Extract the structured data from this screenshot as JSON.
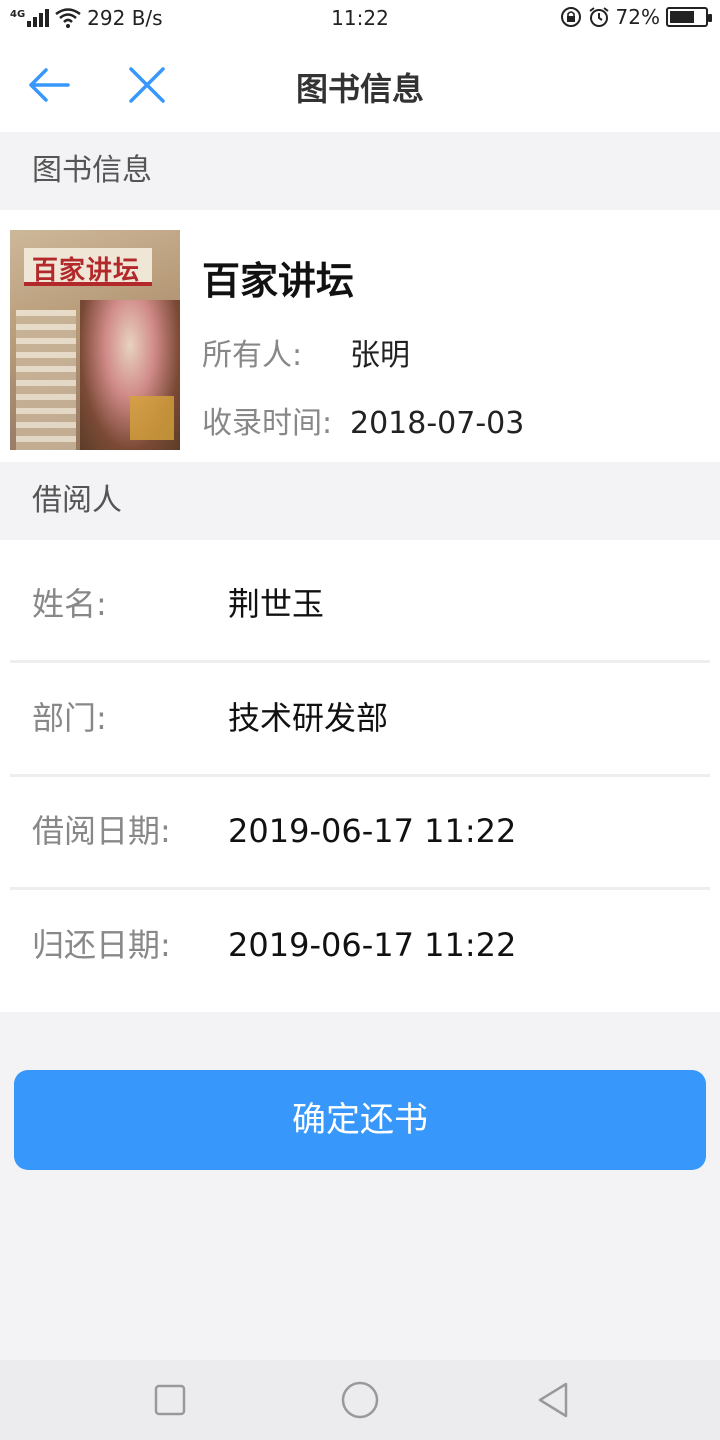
{
  "status_bar": {
    "signal": "4G",
    "speed": "292 B/s",
    "time": "11:22",
    "battery": "72%",
    "battery_level": 0.72
  },
  "header": {
    "title": "图书信息"
  },
  "book_section": {
    "label": "图书信息",
    "cover_title": "百家讲坛",
    "name": "百家讲坛",
    "owner_label": "所有人:",
    "owner": "张明",
    "recorded_label": "收录时间:",
    "recorded": "2018-07-03"
  },
  "borrower_section": {
    "label": "借阅人",
    "rows": [
      {
        "label": "姓名:",
        "value": "荆世玉"
      },
      {
        "label": "部门:",
        "value": "技术研发部"
      },
      {
        "label": "借阅日期:",
        "value": "2019-06-17 11:22"
      },
      {
        "label": "归还日期:",
        "value": "2019-06-17 11:22"
      }
    ]
  },
  "confirm_button": {
    "label": "确定还书"
  },
  "colors": {
    "accent": "#3797fb",
    "background": "#f3f3f5"
  },
  "icons": {
    "back": "arrow-left-icon",
    "close": "close-icon",
    "nav_square": "square-icon",
    "nav_circle": "circle-icon",
    "nav_triangle": "triangle-back-icon"
  }
}
